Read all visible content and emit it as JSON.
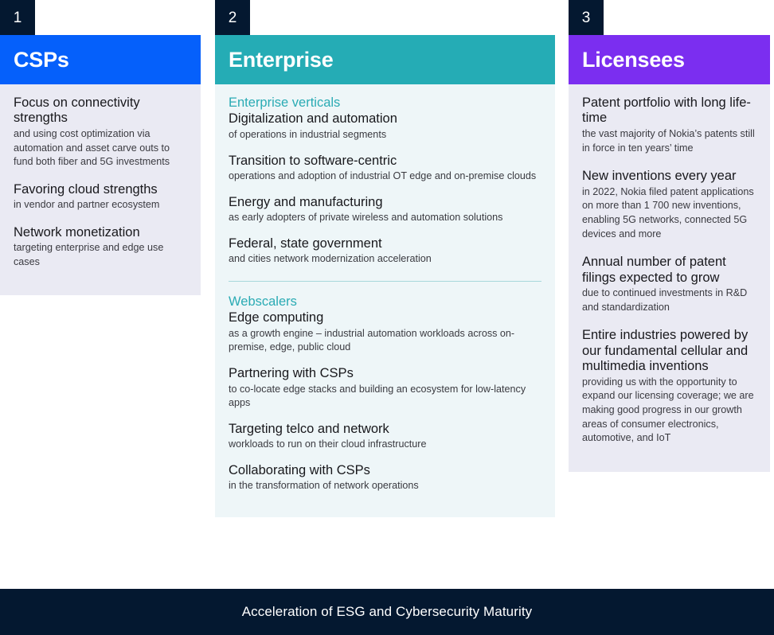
{
  "columns": [
    {
      "number": "1",
      "title": "CSPs",
      "accent": "#0560fb",
      "body_bg": "#eaeaf3",
      "blocks": [
        {
          "lead": "Focus on connectivity strengths",
          "sub": "and using cost optimization via automation and asset carve outs to fund both fiber and 5G investments"
        },
        {
          "lead": "Favoring cloud strengths",
          "sub": "in vendor and partner ecosystem"
        },
        {
          "lead": "Network monetization",
          "sub": "targeting enterprise and edge use cases"
        }
      ]
    },
    {
      "number": "2",
      "title": "Enterprise",
      "accent": "#25acb5",
      "body_bg": "#eef6f8",
      "group_1_label": "Enterprise verticals",
      "group_1_blocks": [
        {
          "lead": "Digitalization and automation",
          "sub": "of operations in industrial segments"
        },
        {
          "lead": "Transition to software-centric",
          "sub": "operations and adoption of industrial OT edge and on-premise clouds"
        },
        {
          "lead": "Energy and manufacturing",
          "sub": "as early adopters of private wireless and automation solutions"
        },
        {
          "lead": "Federal, state government",
          "sub": "and cities network modernization acceleration"
        }
      ],
      "group_2_label": "Webscalers",
      "group_2_blocks": [
        {
          "lead": "Edge computing",
          "sub": "as a growth engine – industrial automation workloads across on-premise, edge, public cloud"
        },
        {
          "lead": "Partnering with CSPs",
          "sub": "to co-locate edge stacks and building an ecosystem for low-latency apps"
        },
        {
          "lead": "Targeting telco and network",
          "sub": "workloads to run on their cloud infrastructure"
        },
        {
          "lead": "Collaborating with CSPs",
          "sub": "in the transformation of network operations"
        }
      ]
    },
    {
      "number": "3",
      "title": "Licensees",
      "accent": "#7b2ef0",
      "body_bg": "#eaeaf3",
      "blocks": [
        {
          "lead": "Patent portfolio with long life-time",
          "sub": "the vast majority of Nokia’s patents still in force in ten years’ time"
        },
        {
          "lead": "New inventions every year",
          "sub": "in 2022, Nokia filed patent applications on more than 1 700 new inventions, enabling 5G networks, connected 5G devices and more"
        },
        {
          "lead": "Annual number of patent filings expected to grow",
          "sub": "due to continued investments in R&D and standardization"
        },
        {
          "lead": "Entire industries powered by our fundamental cellular and multimedia inventions",
          "sub": "providing us with the opportunity to expand our licensing coverage; we are making good progress in our growth areas of consumer electronics, automotive, and IoT"
        }
      ]
    }
  ],
  "bottom_banner": {
    "text": "Acceleration of ESG and Cybersecurity Maturity",
    "bg": "#041830"
  }
}
